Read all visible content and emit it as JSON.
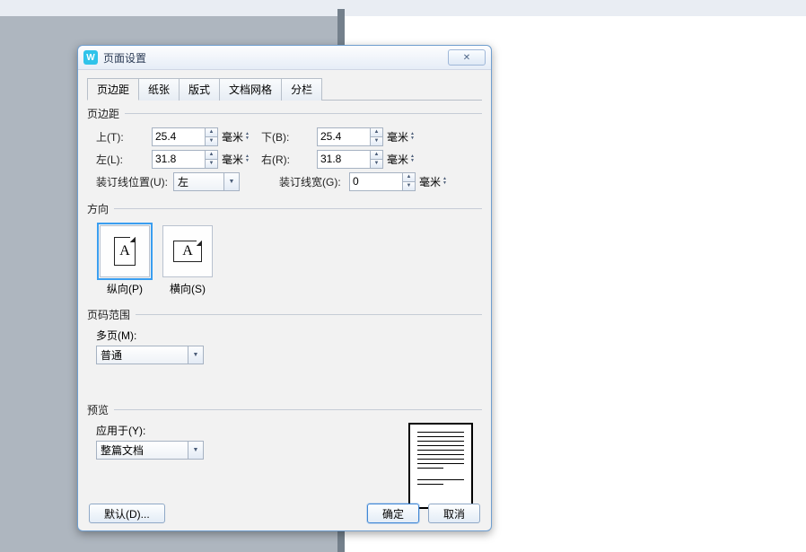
{
  "dialog": {
    "title": "页面设置",
    "app_icon_letter": "W",
    "close_glyph": "✕"
  },
  "tabs": [
    "页边距",
    "纸张",
    "版式",
    "文档网格",
    "分栏"
  ],
  "margins": {
    "legend": "页边距",
    "top_label": "上(T):",
    "top_value": "25.4",
    "bottom_label": "下(B):",
    "bottom_value": "25.4",
    "left_label": "左(L):",
    "left_value": "31.8",
    "right_label": "右(R):",
    "right_value": "31.8",
    "gutter_pos_label": "装订线位置(U):",
    "gutter_pos_value": "左",
    "gutter_width_label": "装订线宽(G):",
    "gutter_width_value": "0",
    "unit": "毫米"
  },
  "orientation": {
    "legend": "方向",
    "portrait_label": "纵向(P)",
    "landscape_label": "横向(S)",
    "glyph": "A"
  },
  "page_scope": {
    "legend": "页码范围",
    "multi_label": "多页(M):",
    "multi_value": "普通"
  },
  "preview": {
    "legend": "预览",
    "apply_label": "应用于(Y):",
    "apply_value": "整篇文档"
  },
  "buttons": {
    "default": "默认(D)...",
    "ok": "确定",
    "cancel": "取消"
  },
  "arrows": {
    "up": "▲",
    "down": "▼"
  }
}
